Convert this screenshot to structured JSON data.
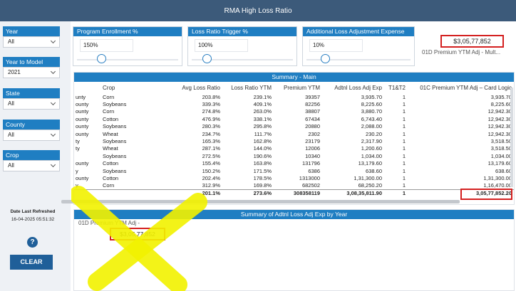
{
  "app": {
    "title": "RMA High Loss Ratio"
  },
  "filters": [
    {
      "label": "Year",
      "value": "All"
    },
    {
      "label": "Year to Model",
      "value": "2021"
    },
    {
      "label": "State",
      "value": "All"
    },
    {
      "label": "County",
      "value": "All"
    },
    {
      "label": "Crop",
      "value": "All"
    }
  ],
  "params": [
    {
      "title": "Program Enrollment %",
      "value": "150%",
      "fraction": 0.22
    },
    {
      "title": "Loss Ratio Trigger %",
      "value": "100%",
      "fraction": 0.12
    },
    {
      "title": "Additional Loss Adjustment Expense",
      "value": "10%",
      "fraction": 0.15
    }
  ],
  "kpi": {
    "value": "$3,05,77,852",
    "label": "01D Premium YTM Adj - Mult..."
  },
  "summary": {
    "title": "Summary - Main",
    "columns": [
      "",
      "Crop",
      "Avg Loss Ratio",
      "Loss Ratio YTM",
      "Premium YTM",
      "Adtnl Loss Adj Exp",
      "T1&T2",
      "01C Premium YTM Adj – Card Logic"
    ],
    "rows": [
      [
        "unty",
        "Corn",
        "203.8%",
        "239.1%",
        "39357",
        "3,935.70",
        "1",
        "3,935.70"
      ],
      [
        "ounty",
        "Soybeans",
        "339.3%",
        "409.1%",
        "82256",
        "8,225.60",
        "1",
        "8,225.60"
      ],
      [
        "ounty",
        "Corn",
        "274.8%",
        "263.0%",
        "38807",
        "3,880.70",
        "1",
        "12,942.30"
      ],
      [
        "ounty",
        "Cotton",
        "476.9%",
        "338.1%",
        "67434",
        "6,743.40",
        "1",
        "12,942.30"
      ],
      [
        "ounty",
        "Soybeans",
        "280.3%",
        "295.8%",
        "20880",
        "2,088.00",
        "1",
        "12,942.30"
      ],
      [
        "ounty",
        "Wheat",
        "234.7%",
        "111.7%",
        "2302",
        "230.20",
        "1",
        "12,942.30"
      ],
      [
        "ty",
        "Soybeans",
        "165.3%",
        "162.8%",
        "23179",
        "2,317.90",
        "1",
        "3,518.50"
      ],
      [
        "ty",
        "Wheat",
        "287.1%",
        "144.0%",
        "12006",
        "1,200.60",
        "1",
        "3,518.50"
      ],
      [
        "",
        "Soybeans",
        "272.5%",
        "190.6%",
        "10340",
        "1,034.00",
        "1",
        "1,034.00"
      ],
      [
        "ounty",
        "Cotton",
        "155.4%",
        "163.8%",
        "131796",
        "13,179.60",
        "1",
        "13,179.60"
      ],
      [
        "y",
        "Soybeans",
        "150.2%",
        "171.5%",
        "6386",
        "638.60",
        "1",
        "638.60"
      ],
      [
        "ounty",
        "Cotton",
        "202.4%",
        "178.5%",
        "1313000",
        "1,31,300.00",
        "1",
        "1,31,300.00"
      ],
      [
        "y",
        "Corn",
        "312.9%",
        "169.8%",
        "682502",
        "68,250.20",
        "1",
        "1,16,470.00"
      ]
    ],
    "total": [
      "",
      "",
      "201.1%",
      "273.6%",
      "308358119",
      "3,08,35,811.90",
      "1",
      "3,05,77,852.20"
    ]
  },
  "adtnl": {
    "title": "Summary of Adtnl Loss Adj Exp by Year",
    "label": "01D Premium YTM Adj -",
    "value": "$3,05,77,852"
  },
  "refresh": {
    "label": "Date Last Refreshed",
    "value": "16-04-2025 05:51:32"
  },
  "help_label": "?",
  "clear_label": "CLEAR",
  "colors": {
    "header": "#3c5a7a",
    "accent": "#1f7ec2",
    "highlight": "#d42020",
    "annotation": "#f2f200"
  }
}
